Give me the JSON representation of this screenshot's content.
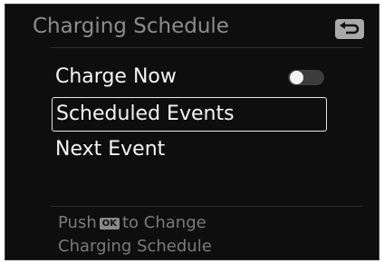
{
  "header": {
    "title": "Charging Schedule",
    "back_icon": "back-return-icon"
  },
  "menu": {
    "items": [
      {
        "label": "Charge Now",
        "toggle": "off"
      },
      {
        "label": "Scheduled Events",
        "selected": true
      },
      {
        "label": "Next Event"
      }
    ]
  },
  "footer": {
    "push_prefix": "Push",
    "ok_label": "OK",
    "push_suffix": "to Change",
    "line2": "Charging Schedule"
  }
}
